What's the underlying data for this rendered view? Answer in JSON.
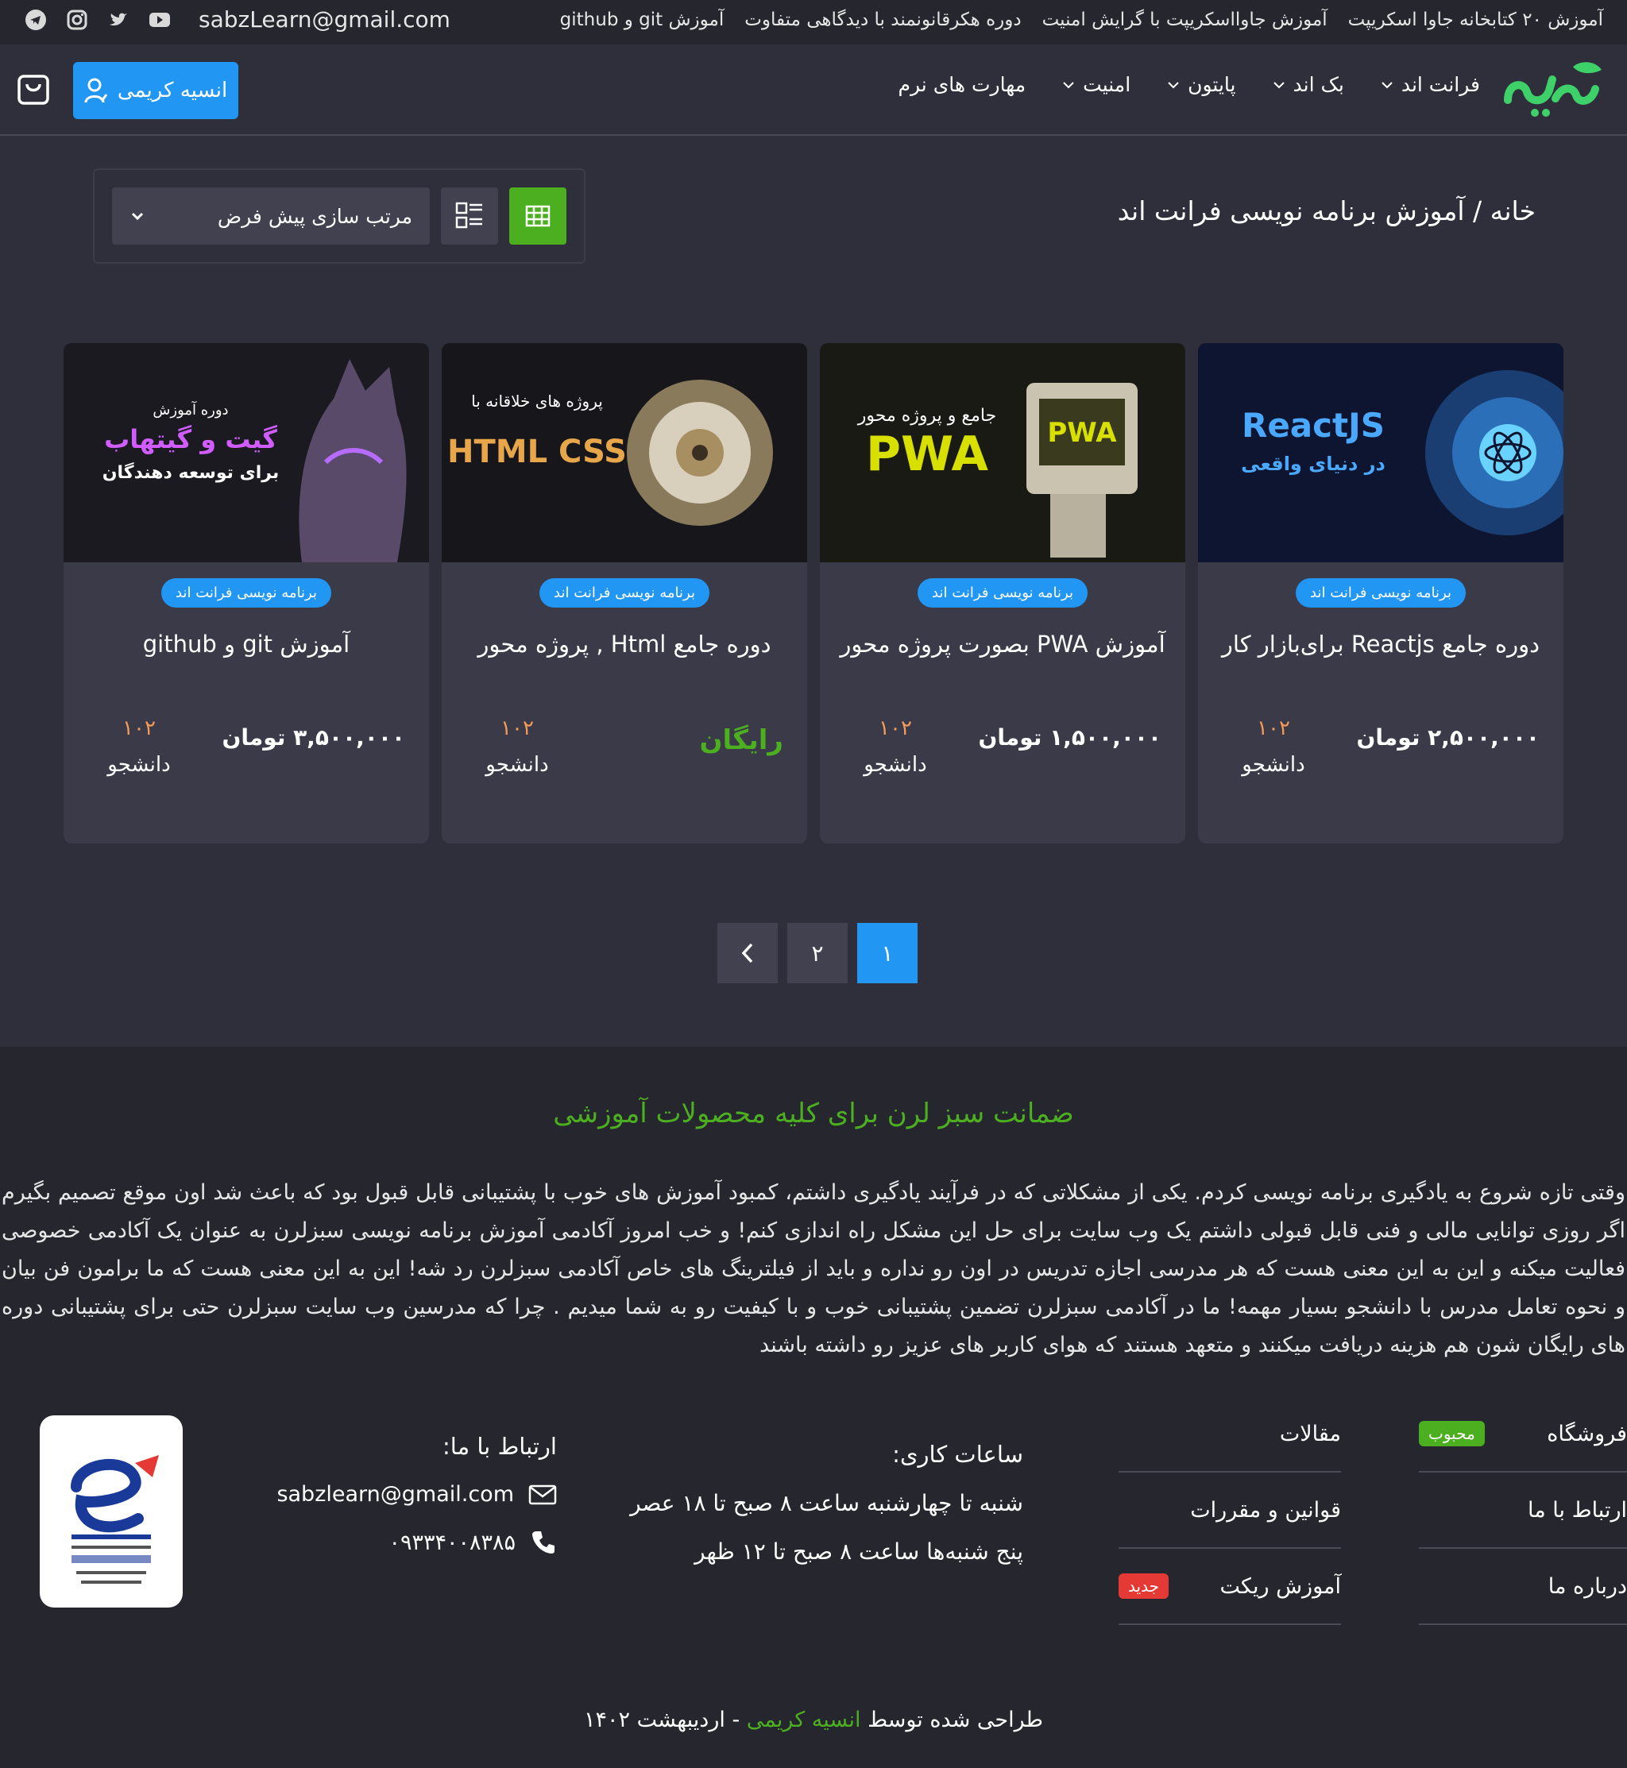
{
  "topbar": {
    "links": [
      "آموزش ۲۰ کتابخانه جاوا اسکریپت",
      "آموزش جاوااسکریپت با گرایش امنیت",
      "دوره هکرقانونمند با دیدگاهی متفاوت",
      "آموزش git و github"
    ],
    "email": "sabzLearn@gmail.com",
    "socials": [
      "youtube-icon",
      "twitter-icon",
      "instagram-icon",
      "telegram-icon"
    ]
  },
  "header": {
    "logo_text": "سبزلرن",
    "nav": [
      "فرانت اند",
      "بک اند",
      "پایتون",
      "امنیت",
      "مهارت های نرم"
    ],
    "user_button": "انسیه کریمی"
  },
  "page": {
    "breadcrumb": "خانه / آموزش برنامه نویسی فرانت اند",
    "sort_label": "مرتب سازی پیش فرض"
  },
  "courses": [
    {
      "category": "برنامه نویسی فرانت اند",
      "title": "دوره جامع Reactjs برای‌بازار کار",
      "price": "۲,۵۰۰,۰۰۰ تومان",
      "students": "۱۰۲",
      "students_label": "دانشجو",
      "thumb_line1": "ReactJS",
      "thumb_line2": "در دنیای واقعی"
    },
    {
      "category": "برنامه نویسی فرانت اند",
      "title": "آموزش PWA بصورت پروژه محور",
      "price": "۱,۵۰۰,۰۰۰ تومان",
      "students": "۱۰۲",
      "students_label": "دانشجو",
      "thumb_line1": "PWA",
      "thumb_line2": "جامع و پروژه محور"
    },
    {
      "category": "برنامه نویسی فرانت اند",
      "title": "دوره جامع Html , پروژه محور",
      "price": "رایگان",
      "students": "۱۰۲",
      "students_label": "دانشجو",
      "thumb_line1": "HTML CSS",
      "thumb_line2": "پروژه های خلاقانه با"
    },
    {
      "category": "برنامه نویسی فرانت اند",
      "title": "آموزش git و github",
      "price": "۳,۵۰۰,۰۰۰ تومان",
      "students": "۱۰۲",
      "students_label": "دانشجو",
      "thumb_line1": "گیت و گیتهاب",
      "thumb_line2": "برای توسعه دهندگان"
    }
  ],
  "pagination": {
    "pages": [
      "۱",
      "۲"
    ],
    "active": "۱",
    "next_icon": "chevron-left-icon"
  },
  "footer": {
    "guarantee_title": "ضمانت سبز لرن برای کلیه محصولات آموزشی",
    "guarantee_text": "وقتی تازه شروع به یادگیری برنامه نویسی کردم. یکی از مشکلاتی که در فرآیند یادگیری داشتم، کمبود آموزش های خوب با پشتیبانی قابل قبول بود که باعث شد اون موقع تصمیم بگیرم اگر روزی توانایی مالی و فنی قابل قبولی داشتم یک وب سایت برای حل این مشکل راه اندازی کنم! و خب امروز آکادمی آموزش برنامه نویسی سبزلرن به عنوان یک آکادمی خصوصی فعالیت میکنه و این به این معنی هست که هر مدرسی اجازه تدریس در اون رو نداره و باید از فیلترینگ های خاص آکادمی سبزلرن رد شه! این به این معنی هست که ما برامون فن بیان و نحوه تعامل مدرس با دانشجو بسیار مهمه! ما در آکادمی سبزلرن تضمین پشتیبانی خوب و با کیفیت رو به شما میدیم . چرا که مدرسین وب سایت سبزلرن حتی برای پشتیبانی دوره های رایگان شون هم هزینه دریافت میکنند و متعهد هستند که هوای کاربر های عزیز رو داشته باشند",
    "links_col1": [
      {
        "label": "فروشگاه",
        "badge": "محبوب"
      },
      {
        "label": "ارتباط با ما",
        "badge": ""
      },
      {
        "label": "درباره ما",
        "badge": ""
      }
    ],
    "links_col2": [
      {
        "label": "مقالات",
        "badge": ""
      },
      {
        "label": "قوانین و مقررات",
        "badge": ""
      },
      {
        "label": "آموزش ریکت",
        "badge": "جدید"
      }
    ],
    "hours": {
      "title": "ساعات کاری:",
      "line1": "شنبه تا چهارشنبه ساعت ۸ صبح تا ۱۸ عصر",
      "line2": "پنج شنبه‌ها ساعت ۸ صبح تا ۱۲ ظهر"
    },
    "contact": {
      "title": "ارتباط با ما:",
      "email": "sabzlearn@gmail.com",
      "phone": "۰۹۳۳۴۰۰۸۳۸۵"
    },
    "copyright_prefix": "طراحی شده توسط",
    "copyright_name": "انسیه کریمی",
    "copyright_suffix": "- اردیبهشت ۱۴۰۲"
  },
  "colors": {
    "accent_green": "#4caf1f",
    "accent_blue": "#2196f3",
    "bg": "#2f2f3b",
    "card": "#3a3a48",
    "students_orange": "#f39c5a"
  }
}
